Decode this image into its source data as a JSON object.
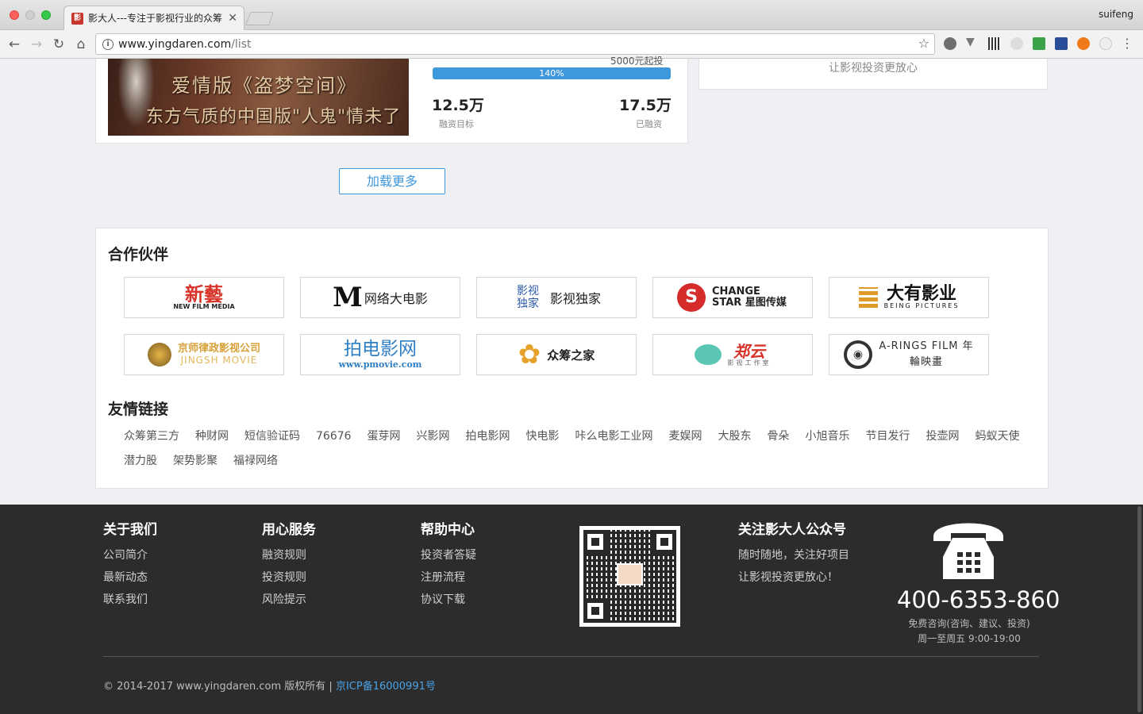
{
  "browser": {
    "tab_title": "影大人---专注于影视行业的众筹",
    "tab_favicon": "影",
    "tab_close": "✕",
    "user": "suifeng",
    "url_host": "www.yingdaren.com",
    "url_path": "/list"
  },
  "project": {
    "poster_line1": "爱情版《盗梦空间》",
    "poster_line2": "东方气质的中国版\"人鬼\"情未了",
    "cut_note": "5000元起投",
    "progress_percent": 140,
    "progress_label": "140%",
    "target_value": "12.5万",
    "target_label": "融资目标",
    "raised_value": "17.5万",
    "raised_label": "已融资"
  },
  "side_card": {
    "text": "让影视投资更放心"
  },
  "load_more": "加载更多",
  "partners": {
    "title": "合作伙伴",
    "logos": [
      {
        "mark": "新藝",
        "sub": "NEW FILM MEDIA",
        "color": "#d8342a"
      },
      {
        "mark": "M",
        "text": "网络大电影",
        "color": "#111111"
      },
      {
        "mark": "影视独家",
        "text": "影视独家",
        "color": "#2b5aa8"
      },
      {
        "mark": "S",
        "text": "CHANGE STAR 星图传媒",
        "color": "#d52b2b"
      },
      {
        "mark": "大有影业",
        "sub": "BEING PICTURES",
        "color": "#111111"
      },
      {
        "mark": "京师律政影视公司",
        "sub": "JINGSH MOVIE",
        "color": "#d8a13a"
      },
      {
        "mark": "拍电影网",
        "sub": "www.pmovie.com",
        "color": "#2f7fc5"
      },
      {
        "mark": "✿",
        "text": "众筹之家",
        "color": "#e5a12a"
      },
      {
        "mark": "郑云",
        "sub": "影视工作室",
        "color": "#d8342a"
      },
      {
        "mark": "◉",
        "text": "A-RINGS FILM 年輪映畫",
        "color": "#333333"
      }
    ]
  },
  "friend_links": {
    "title": "友情链接",
    "items": [
      "众筹第三方",
      "种财网",
      "短信验证码",
      "76676",
      "蛋芽网",
      "兴影网",
      "拍电影网",
      "快电影",
      "咔么电影工业网",
      "麦娱网",
      "大股东",
      "骨朵",
      "小旭音乐",
      "节目发行",
      "投壶网",
      "蚂蚁天使",
      "潜力股",
      "架势影聚",
      "福禄网络"
    ]
  },
  "footer": {
    "about": {
      "title": "关于我们",
      "items": [
        "公司简介",
        "最新动态",
        "联系我们"
      ]
    },
    "service": {
      "title": "用心服务",
      "items": [
        "融资规则",
        "投资规则",
        "风险提示"
      ]
    },
    "help": {
      "title": "帮助中心",
      "items": [
        "投资者答疑",
        "注册流程",
        "协议下载"
      ]
    },
    "wechat": {
      "title": "关注影大人公众号",
      "items": [
        "随时随地，关注好项目",
        "让影视投资更放心！"
      ]
    },
    "phone": "400-6353-860",
    "phone_sub1": "免费咨询(咨询、建议、投资)",
    "phone_sub2": "周一至周五 9:00-19:00",
    "copyright": "© 2014-2017 www.yingdaren.com 版权所有 | ",
    "icp": "京ICP备16000991号"
  },
  "colors": {
    "accent": "#3f97dc",
    "footer_bg": "#2c2c2c",
    "page_bg": "#eef0f3"
  }
}
